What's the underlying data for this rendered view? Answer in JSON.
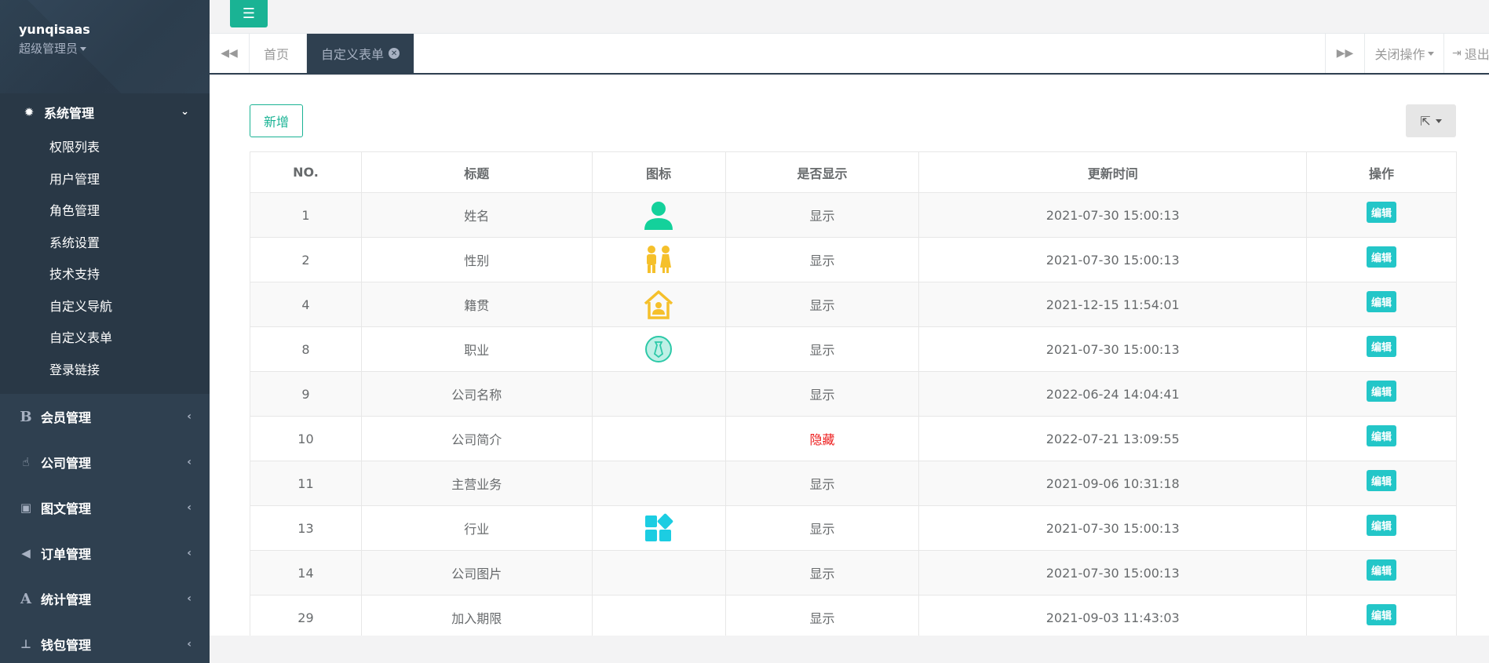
{
  "profile": {
    "username": "yunqisaas",
    "role": "超级管理员"
  },
  "sidebar": {
    "active_group": {
      "label": "系统管理",
      "icon": "gear-icon",
      "items": [
        "权限列表",
        "用户管理",
        "角色管理",
        "系统设置",
        "技术支持",
        "自定义导航",
        "自定义表单",
        "登录链接"
      ]
    },
    "groups": [
      {
        "label": "会员管理",
        "icon": "bold-icon"
      },
      {
        "label": "公司管理",
        "icon": "hand-icon"
      },
      {
        "label": "图文管理",
        "icon": "image-icon"
      },
      {
        "label": "订单管理",
        "icon": "bullhorn-icon"
      },
      {
        "label": "统计管理",
        "icon": "font-icon"
      },
      {
        "label": "钱包管理",
        "icon": "wallet-icon"
      }
    ]
  },
  "tabs": {
    "home": "首页",
    "current": "自定义表单",
    "close_ops": "关闭操作",
    "logout": "退出"
  },
  "toolbar": {
    "add_label": "新增"
  },
  "table": {
    "headers": [
      "NO.",
      "标题",
      "图标",
      "是否显示",
      "更新时间",
      "操作"
    ],
    "edit_label": "编辑",
    "rows": [
      {
        "no": "1",
        "title": "姓名",
        "icon": "person-icon",
        "display": "显示",
        "updated": "2021-07-30 15:00:13"
      },
      {
        "no": "2",
        "title": "性别",
        "icon": "gender-icon",
        "display": "显示",
        "updated": "2021-07-30 15:00:13"
      },
      {
        "no": "4",
        "title": "籍贯",
        "icon": "home-icon",
        "display": "显示",
        "updated": "2021-12-15 11:54:01"
      },
      {
        "no": "8",
        "title": "职业",
        "icon": "tie-icon",
        "display": "显示",
        "updated": "2021-07-30 15:00:13"
      },
      {
        "no": "9",
        "title": "公司名称",
        "icon": "",
        "display": "显示",
        "updated": "2022-06-24 14:04:41"
      },
      {
        "no": "10",
        "title": "公司简介",
        "icon": "",
        "display": "隐藏",
        "updated": "2022-07-21 13:09:55"
      },
      {
        "no": "11",
        "title": "主营业务",
        "icon": "",
        "display": "显示",
        "updated": "2021-09-06 10:31:18"
      },
      {
        "no": "13",
        "title": "行业",
        "icon": "apps-icon",
        "display": "显示",
        "updated": "2021-07-30 15:00:13"
      },
      {
        "no": "14",
        "title": "公司图片",
        "icon": "",
        "display": "显示",
        "updated": "2021-07-30 15:00:13"
      },
      {
        "no": "29",
        "title": "加入期限",
        "icon": "",
        "display": "显示",
        "updated": "2021-09-03 11:43:03"
      }
    ]
  },
  "colors": {
    "sidebar": "#2f4050",
    "primary": "#1ab394",
    "info": "#23c6c8",
    "danger": "#ed1c1c"
  }
}
